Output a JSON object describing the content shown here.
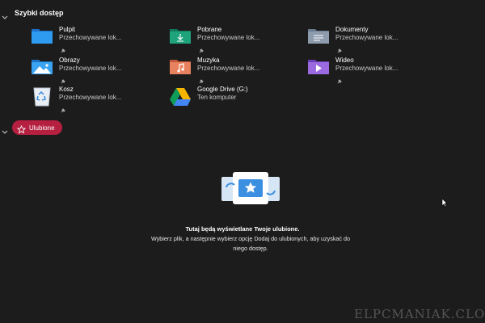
{
  "quick_access": {
    "title": "Szybki dostęp",
    "items": [
      {
        "name": "Pulpit",
        "sub": "Przechowywane lok...",
        "icon": "desktop-folder-icon"
      },
      {
        "name": "Pobrane",
        "sub": "Przechowywane lok...",
        "icon": "downloads-folder-icon"
      },
      {
        "name": "Dokumenty",
        "sub": "Przechowywane lok...",
        "icon": "documents-folder-icon"
      },
      {
        "name": "Obrazy",
        "sub": "Przechowywane lok...",
        "icon": "pictures-folder-icon"
      },
      {
        "name": "Muzyka",
        "sub": "Przechowywane lok...",
        "icon": "music-folder-icon"
      },
      {
        "name": "Wideo",
        "sub": "Przechowywane lok...",
        "icon": "videos-folder-icon"
      },
      {
        "name": "Kosz",
        "sub": "Przechowywane lok...",
        "icon": "recycle-bin-icon"
      },
      {
        "name": "Google Drive (G:)",
        "sub": "Ten komputer",
        "icon": "google-drive-icon"
      }
    ]
  },
  "favorites": {
    "label": "Ulubione",
    "accent": "#b51f40",
    "empty_title": "Tutaj będą wyświetlane Twoje ulubione.",
    "empty_desc": "Wybierz plik, a następnie wybierz opcję Dodaj do ulubionych, aby uzyskać do niego dostęp."
  },
  "watermark": "ELPCMANIAK.CLOU"
}
